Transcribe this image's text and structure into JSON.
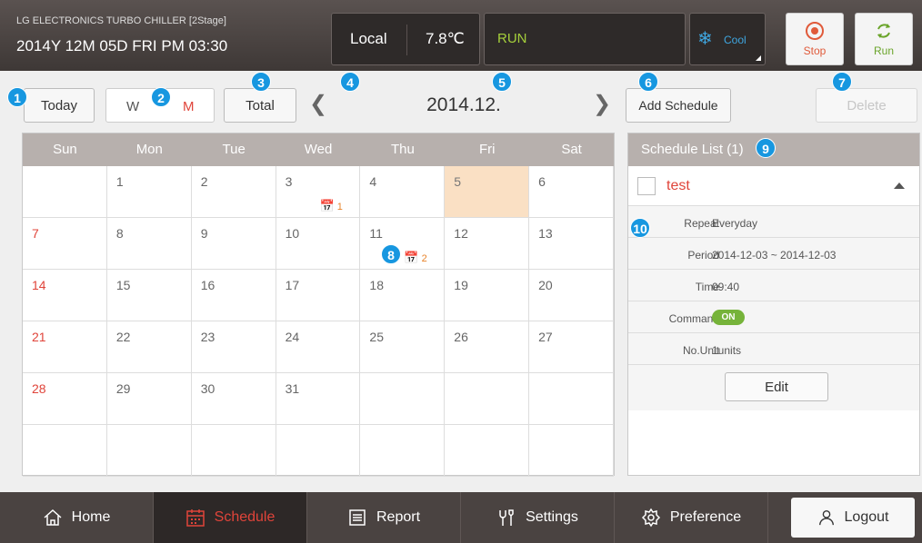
{
  "header": {
    "model": "LG ELECTRONICS TURBO CHILLER [2Stage]",
    "datetime": "2014Y 12M 05D  FRI PM 03:30",
    "mode_local": "Local",
    "temperature": "7.8℃",
    "run_status": "RUN",
    "op_mode": "Cool",
    "stop_label": "Stop",
    "run_label": "Run"
  },
  "toolbar": {
    "today": "Today",
    "week": "W",
    "month": "M",
    "total": "Total",
    "month_title": "2014.12.",
    "add_schedule": "Add Schedule",
    "delete": "Delete"
  },
  "markers": [
    "1",
    "2",
    "3",
    "4",
    "5",
    "6",
    "7",
    "8",
    "9",
    "10"
  ],
  "calendar": {
    "weekdays": [
      "Sun",
      "Mon",
      "Tue",
      "Wed",
      "Thu",
      "Fri",
      "Sat"
    ],
    "weeks": [
      [
        "",
        "1",
        "2",
        "3",
        "4",
        "5",
        "6"
      ],
      [
        "7",
        "8",
        "9",
        "10",
        "11",
        "12",
        "13"
      ],
      [
        "14",
        "15",
        "16",
        "17",
        "18",
        "19",
        "20"
      ],
      [
        "21",
        "22",
        "23",
        "24",
        "25",
        "26",
        "27"
      ],
      [
        "28",
        "29",
        "30",
        "31",
        "",
        "",
        ""
      ],
      [
        "",
        "",
        "",
        "",
        "",
        "",
        ""
      ]
    ],
    "events": [
      {
        "day": "3",
        "count": "1"
      },
      {
        "day": "11",
        "count": "2"
      }
    ],
    "today_day": "5",
    "colors": {
      "sunday": "#e0443a",
      "today_bg": "#fae0c4",
      "event": "#e8832a"
    }
  },
  "schedule_list": {
    "title": "Schedule List (1)",
    "item_name": "test",
    "details": [
      {
        "key": "Repeat",
        "value": "Everyday"
      },
      {
        "key": "Period",
        "value": "2014-12-03 ~ 2014-12-03"
      },
      {
        "key": "Time",
        "value": "09:40"
      },
      {
        "key": "Command",
        "value": "ON"
      },
      {
        "key": "No.Unit",
        "value": "1units"
      }
    ],
    "edit": "Edit"
  },
  "bottom_nav": {
    "home": "Home",
    "schedule": "Schedule",
    "report": "Report",
    "settings": "Settings",
    "preference": "Preference",
    "logout": "Logout"
  },
  "colors": {
    "marker": "#1797e0",
    "accent_red": "#e0443a",
    "run_green": "#a5cf3b",
    "cool_blue": "#3fa6e0"
  }
}
